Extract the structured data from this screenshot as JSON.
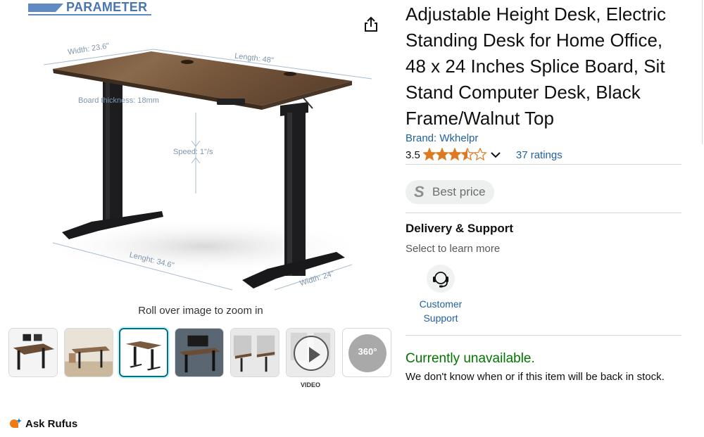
{
  "main_image": {
    "banner_text": "PARAMETER",
    "labels": {
      "width_top": "Width: 23.6\"",
      "length_top": "Length: 48\"",
      "board_thickness": "Board thickness: 18mm",
      "speed": "Speed: 1\"/s",
      "length_bottom": "Lenght: 34.6\"",
      "width_bottom": "Width: 24\""
    },
    "zoom_hint": "Roll over image to zoom in",
    "share_icon": "share-icon"
  },
  "thumbnails": [
    {
      "kind": "image",
      "desc": "desk-with-monitors"
    },
    {
      "kind": "image",
      "desc": "desk-in-room"
    },
    {
      "kind": "image",
      "desc": "desk-parameter",
      "selected": true
    },
    {
      "kind": "image",
      "desc": "desk-dark-room"
    },
    {
      "kind": "image",
      "desc": "desk-lifestyle"
    },
    {
      "kind": "video",
      "label": "VIDEO"
    },
    {
      "kind": "360",
      "label": "360°"
    }
  ],
  "rufus": {
    "label": "Ask Rufus",
    "icon": "rufus-icon"
  },
  "product": {
    "title": "Adjustable Height Desk, Electric Standing Desk for Home Office, 48 x 24 Inches Splice Board, Sit Stand Computer Desk, Black Frame/Walnut Top",
    "brand": "Brand: Wkhelpr",
    "rating_value": "3.5",
    "rating_stars": 3.5,
    "ratings_count": "37 ratings",
    "best_price_label": "Best price",
    "best_price_badge": "S",
    "delivery_title": "Delivery & Support",
    "delivery_sub": "Select to learn more",
    "support_label": "Customer Support",
    "availability": "Currently unavailable.",
    "availability_note": "We don't know when or if this item will be back in stock."
  },
  "colors": {
    "link": "#2162a1",
    "star": "#de7921",
    "availability": "#007600",
    "selected_thumb": "#007185",
    "walnut": "#7a5a3f"
  }
}
